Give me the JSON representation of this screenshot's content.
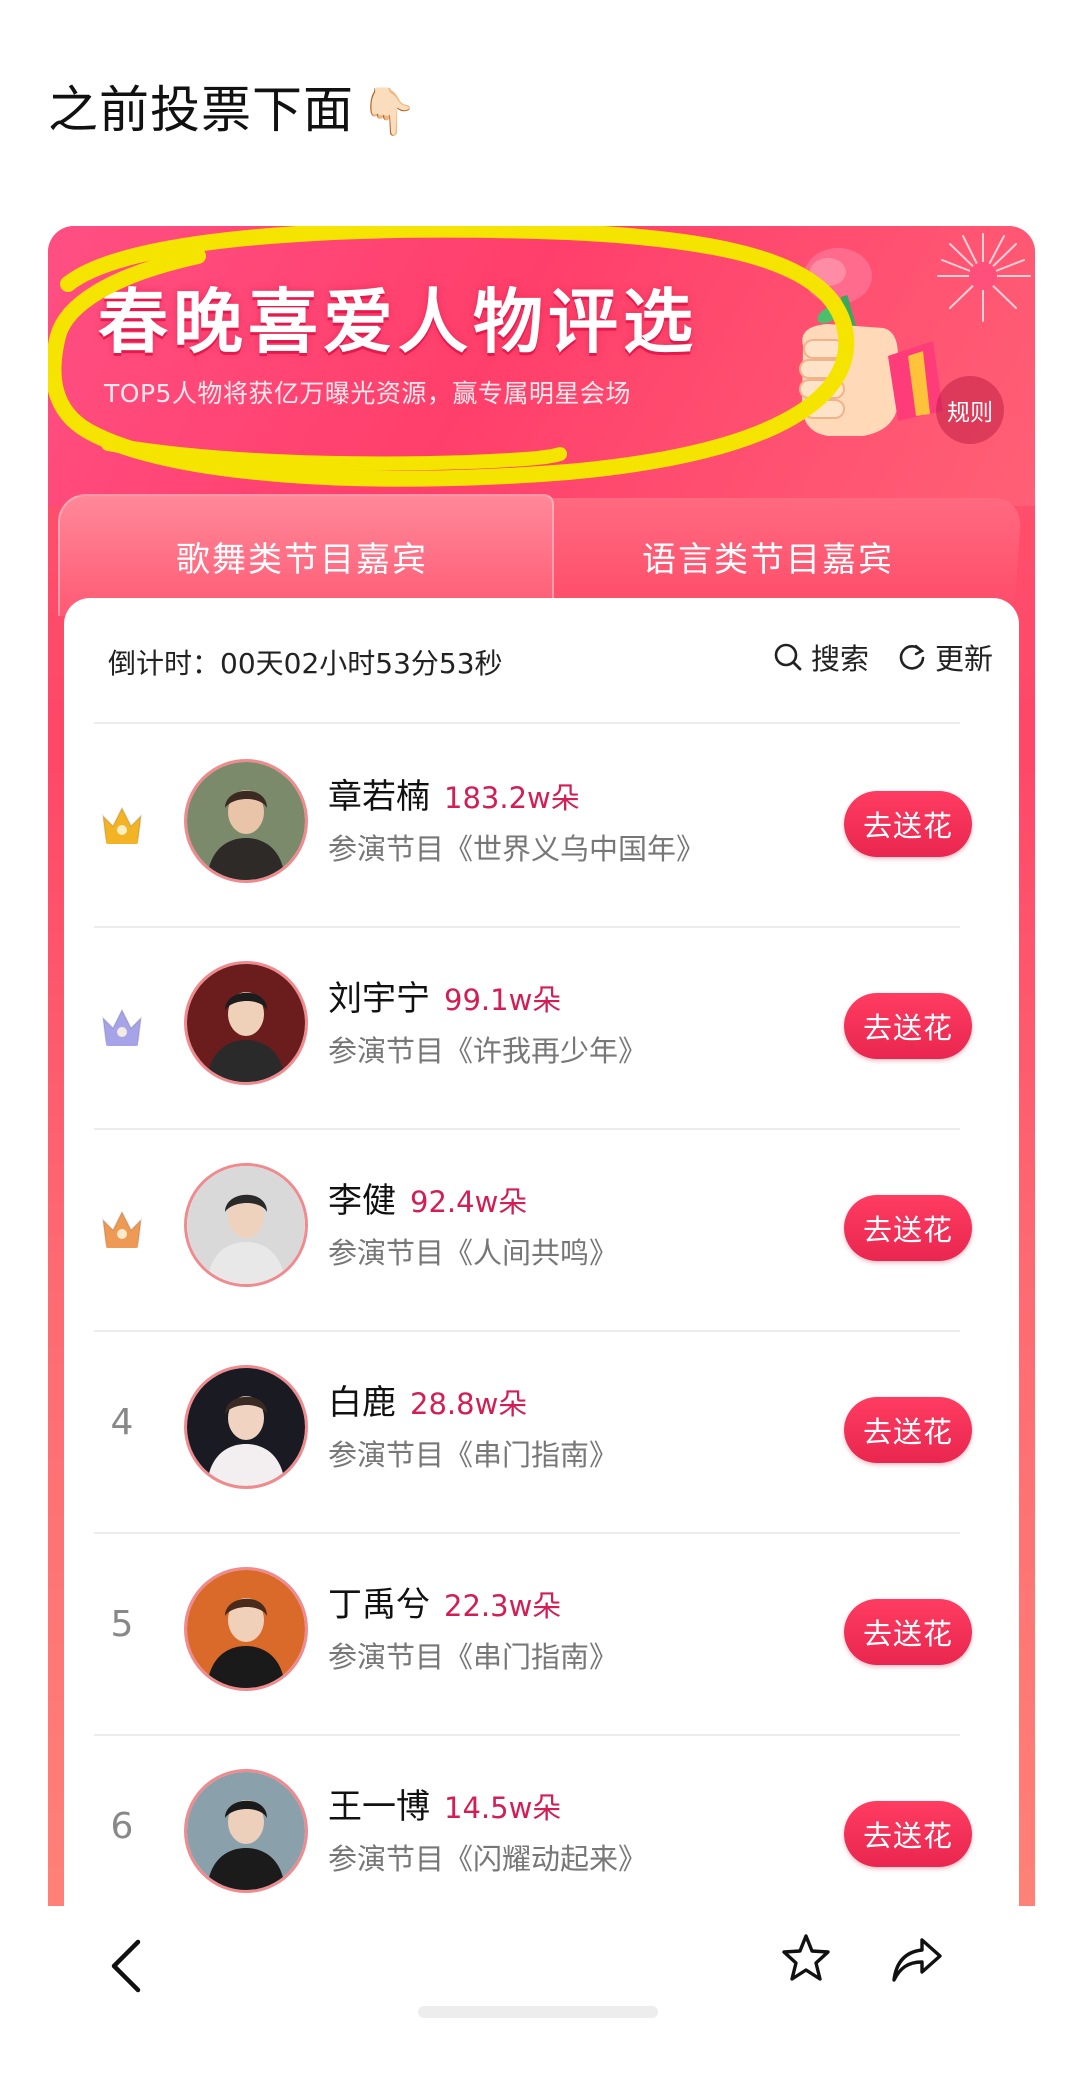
{
  "post": {
    "text": "之前投票下面",
    "emoji": "👇🏻"
  },
  "banner": {
    "title": "春晚喜爱人物评选",
    "subtitle": "TOP5人物将获亿万曝光资源，赢专属明星会场",
    "rules": "规则",
    "highlight_color": "#f5e400"
  },
  "tabs": [
    {
      "label": "歌舞类节目嘉宾"
    },
    {
      "label": "语言类节目嘉宾"
    }
  ],
  "countdown": "倒计时：00天02小时53分53秒",
  "tools": {
    "search": "搜索",
    "refresh": "更新"
  },
  "rows": [
    {
      "rank": "1",
      "badge": "gold-crown",
      "name": "章若楠",
      "flowers": "183.2w朵",
      "program": "参演节目《世界义乌中国年》",
      "button": "去送花"
    },
    {
      "rank": "2",
      "badge": "silver-crown",
      "name": "刘宇宁",
      "flowers": "99.1w朵",
      "program": "参演节目《许我再少年》",
      "button": "去送花"
    },
    {
      "rank": "3",
      "badge": "bronze-crown",
      "name": "李健",
      "flowers": "92.4w朵",
      "program": "参演节目《人间共鸣》",
      "button": "去送花"
    },
    {
      "rank": "4",
      "badge": "",
      "name": "白鹿",
      "flowers": "28.8w朵",
      "program": "参演节目《串门指南》",
      "button": "去送花"
    },
    {
      "rank": "5",
      "badge": "",
      "name": "丁禹兮",
      "flowers": "22.3w朵",
      "program": "参演节目《串门指南》",
      "button": "去送花"
    },
    {
      "rank": "6",
      "badge": "",
      "name": "王一博",
      "flowers": "14.5w朵",
      "program": "参演节目《闪耀动起来》",
      "button": "去送花"
    }
  ],
  "colors": {
    "accent": "#ff3c61",
    "flower_count": "#d21e54",
    "gold": "#f2b325",
    "silver": "#a7a3e8",
    "bronze": "#ee9a55"
  },
  "bottom_bar": {
    "icons": [
      "back-icon",
      "star-icon",
      "share-icon"
    ]
  }
}
